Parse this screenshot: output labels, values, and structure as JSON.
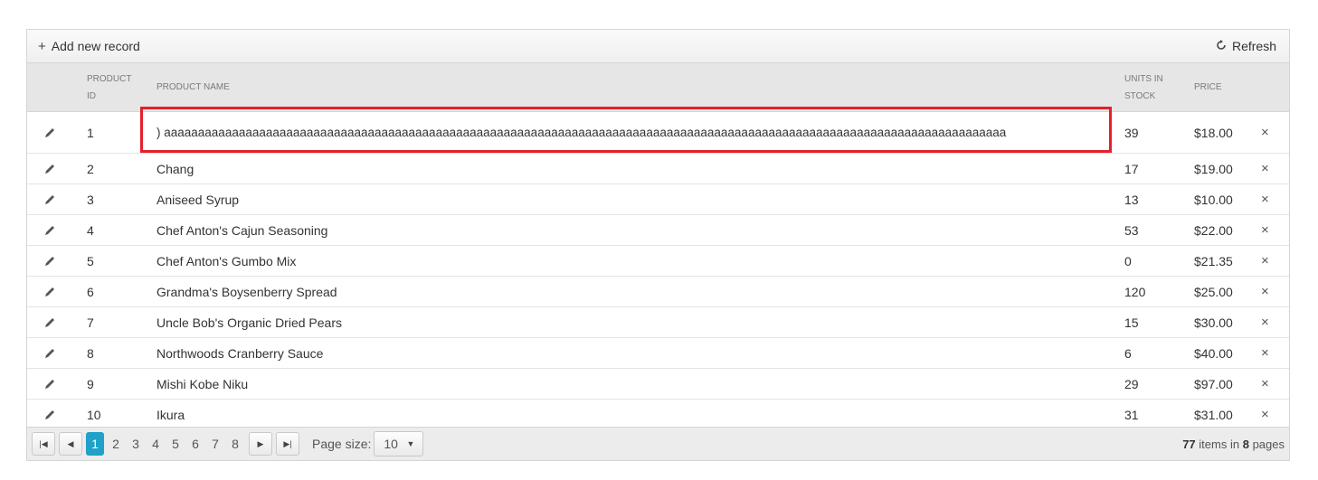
{
  "toolbar": {
    "add_label": "Add new record",
    "add_icon": "plus-icon",
    "refresh_label": "Refresh",
    "refresh_icon": "refresh-icon"
  },
  "columns": {
    "id_line1": "PRODUCT",
    "id_line2": "ID",
    "name": "PRODUCT NAME",
    "units_line1": "UNITS IN",
    "units_line2": "STOCK",
    "price": "PRICE"
  },
  "rows": [
    {
      "id": "1",
      "name": ") aaaaaaaaaaaaaaaaaaaaaaaaaaaaaaaaaaaaaaaaaaaaaaaaaaaaaaaaaaaaaaaaaaaaaaaaaaaaaaaaaaaaaaaaaaaaaaaaaaaaaaaaaaaaaaaaaaaaaaaaaaaa",
      "units": "39",
      "price": "$18.00"
    },
    {
      "id": "2",
      "name": "Chang",
      "units": "17",
      "price": "$19.00"
    },
    {
      "id": "3",
      "name": "Aniseed Syrup",
      "units": "13",
      "price": "$10.00"
    },
    {
      "id": "4",
      "name": "Chef Anton's Cajun Seasoning",
      "units": "53",
      "price": "$22.00"
    },
    {
      "id": "5",
      "name": "Chef Anton's Gumbo Mix",
      "units": "0",
      "price": "$21.35"
    },
    {
      "id": "6",
      "name": "Grandma's Boysenberry Spread",
      "units": "120",
      "price": "$25.00"
    },
    {
      "id": "7",
      "name": "Uncle Bob's Organic Dried Pears",
      "units": "15",
      "price": "$30.00"
    },
    {
      "id": "8",
      "name": "Northwoods Cranberry Sauce",
      "units": "6",
      "price": "$40.00"
    },
    {
      "id": "9",
      "name": "Mishi Kobe Niku",
      "units": "29",
      "price": "$97.00"
    },
    {
      "id": "10",
      "name": "Ikura",
      "units": "31",
      "price": "$31.00"
    }
  ],
  "row_actions": {
    "edit_icon": "pencil-icon",
    "delete_icon": "close-icon",
    "delete_glyph": "×"
  },
  "pager": {
    "pages": [
      "1",
      "2",
      "3",
      "4",
      "5",
      "6",
      "7",
      "8"
    ],
    "current_page": "1",
    "page_size_label": "Page size:",
    "page_size_value": "10",
    "total_items": "77",
    "info_mid": "items in",
    "total_pages": "8",
    "info_end": "pages"
  },
  "colors": {
    "highlight": "#e3202a",
    "active_page": "#1fa1c9"
  }
}
